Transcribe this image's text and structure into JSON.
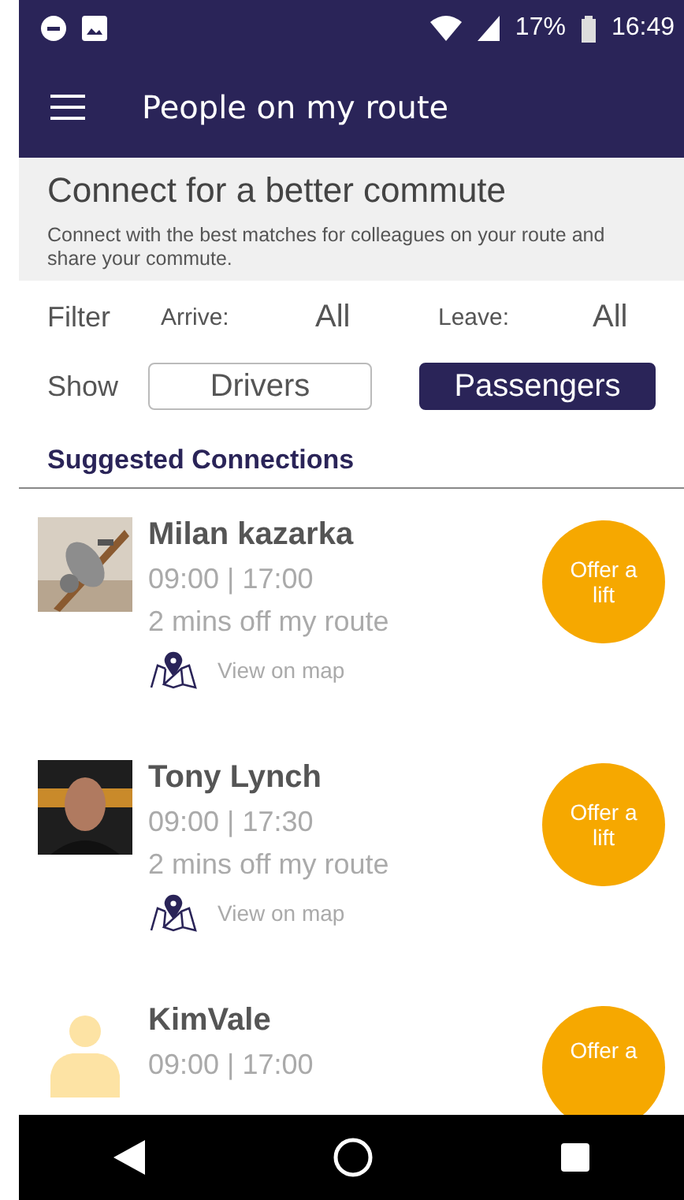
{
  "status_bar": {
    "battery": "17%",
    "time": "16:49"
  },
  "app_bar": {
    "title": "People on my route"
  },
  "header": {
    "title": "Connect for a better commute",
    "subtitle": "Connect with the best matches for colleagues on your route and share your commute."
  },
  "filter": {
    "label": "Filter",
    "arrive_label": "Arrive:",
    "arrive_value": "All",
    "leave_label": "Leave:",
    "leave_value": "All"
  },
  "show": {
    "label": "Show",
    "options": [
      {
        "label": "Drivers",
        "selected": false
      },
      {
        "label": "Passengers",
        "selected": true
      }
    ]
  },
  "section_title": "Suggested Connections",
  "connections": [
    {
      "name": "Milan kazarka",
      "times": "09:00 | 17:00",
      "detour": "2 mins off my route",
      "map_link": "View on map",
      "action": "Offer a lift"
    },
    {
      "name": "Tony Lynch",
      "times": "09:00 | 17:30",
      "detour": "2 mins off my route",
      "map_link": "View on map",
      "action": "Offer a lift"
    },
    {
      "name": "KimVale",
      "times": "09:00 | 17:00",
      "action": "Offer a",
      "kind": "placeholder"
    }
  ]
}
